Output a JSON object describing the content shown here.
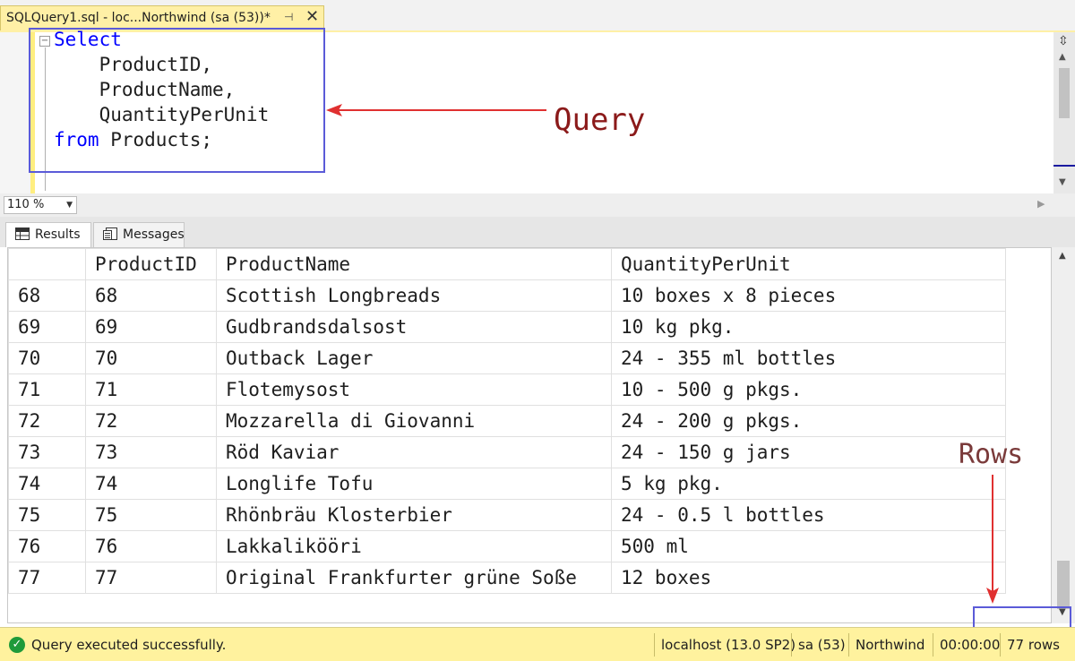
{
  "tab": {
    "title": "SQLQuery1.sql - loc...Northwind (sa (53))*",
    "pin_glyph": "⊣",
    "close_glyph": "✕"
  },
  "editor": {
    "lines": [
      {
        "keyword": "Select",
        "rest": ""
      },
      {
        "keyword": "",
        "rest": "    ProductID,"
      },
      {
        "keyword": "",
        "rest": "    ProductName,"
      },
      {
        "keyword": "",
        "rest": "    QuantityPerUnit"
      },
      {
        "keyword": "from",
        "rest": " Products;"
      }
    ],
    "outline_glyph": "−"
  },
  "annotations": {
    "query_label": "Query",
    "rows_label": "Rows",
    "arrow_color": "#e03030",
    "highlight_color": "#5b5bd8"
  },
  "zoom": {
    "value": "110 %"
  },
  "results_tabs": {
    "results_label": "Results",
    "messages_label": "Messages"
  },
  "grid": {
    "columns": [
      "",
      "ProductID",
      "ProductName",
      "QuantityPerUnit"
    ],
    "rows": [
      [
        "68",
        "68",
        "Scottish Longbreads",
        "10 boxes x 8 pieces"
      ],
      [
        "69",
        "69",
        "Gudbrandsdalsost",
        "10 kg pkg."
      ],
      [
        "70",
        "70",
        "Outback Lager",
        "24 - 355 ml bottles"
      ],
      [
        "71",
        "71",
        "Flotemysost",
        "10 - 500 g pkgs."
      ],
      [
        "72",
        "72",
        "Mozzarella di Giovanni",
        "24 - 200 g pkgs."
      ],
      [
        "73",
        "73",
        "Röd Kaviar",
        "24 - 150 g jars"
      ],
      [
        "74",
        "74",
        "Longlife Tofu",
        "5 kg pkg."
      ],
      [
        "75",
        "75",
        "Rhönbräu Klosterbier",
        "24 - 0.5 l bottles"
      ],
      [
        "76",
        "76",
        "Lakkalikööri",
        "500 ml"
      ],
      [
        "77",
        "77",
        "Original Frankfurter grüne Soße",
        "12 boxes"
      ]
    ]
  },
  "status": {
    "message": "Query executed successfully.",
    "server": "localhost (13.0 SP2)",
    "user": "sa (53)",
    "database": "Northwind",
    "elapsed": "00:00:00",
    "row_count": "77 rows",
    "ok_color": "#1f9a3a"
  }
}
